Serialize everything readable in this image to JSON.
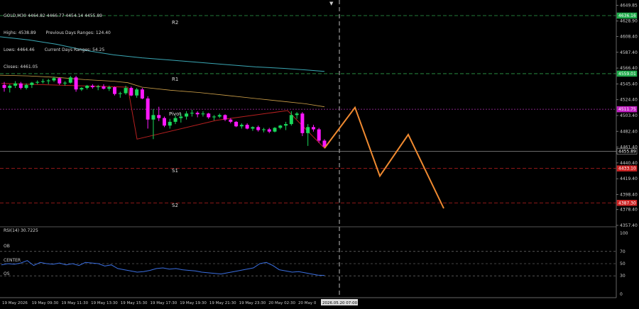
{
  "symbol_line": {
    "symbol": "GOLD,M30",
    "ohlc": "4464.82 4466.77 4454.14 4455.89"
  },
  "stats": {
    "highs": "Highs: 4538.89",
    "prev_range": "Previous Days Ranges: 124.40",
    "lows": "Lows: 4464.46",
    "curr_range": "Current Days Ranges: 54.25",
    "closes": "Closes: 4461.05"
  },
  "dropdown_icon": "triangle-down-icon",
  "pivot_labels": {
    "r2": "R2",
    "r1": "R1",
    "pivot": "Pivot",
    "s1": "S1",
    "s2": "S2"
  },
  "price_axis": {
    "ticks": [
      "4649.85",
      "4628.90",
      "4608.40",
      "4587.40",
      "4566.40",
      "4545.40",
      "4524.40",
      "4503.40",
      "4482.40",
      "4461.40",
      "4440.40",
      "4419.40",
      "4398.40",
      "4378.40",
      "4357.40"
    ],
    "tags": [
      {
        "label": "4636.16",
        "color": "#1faa4a"
      },
      {
        "label": "4559.01",
        "color": "#1faa4a"
      },
      {
        "label": "4511.75",
        "color": "#c020c0"
      },
      {
        "label": "4455.89",
        "color": "#000000"
      },
      {
        "label": "4433.10",
        "color": "#cc2222"
      },
      {
        "label": "4387.30",
        "color": "#cc2222"
      }
    ]
  },
  "rsi": {
    "label": "RSI(14) 30.7225",
    "levels_text": {
      "ob": "OB",
      "center": "CENTER",
      "os": "OS"
    },
    "ticks": [
      "100",
      "70",
      "50",
      "30",
      "0"
    ]
  },
  "time_axis": {
    "labels": [
      "19 May 2026",
      "19 May 09:30",
      "19 May 11:30",
      "19 May 13:30",
      "19 May 15:30",
      "19 May 17:30",
      "19 May 19:30",
      "19 May 21:30",
      "19 May 23:30",
      "20 May 02:30",
      "20 May 0"
    ],
    "crosshair_label": "2026.05.20 07:00"
  },
  "colors": {
    "bull": "#19d85a",
    "bear": "#ff18ff",
    "ma_slow": "#3aa7b4",
    "ma_fast": "#d0a24a",
    "zigzag": "#b82020",
    "forecast": "#f08a30",
    "rsi_line": "#3a6ee0"
  },
  "chart_data": {
    "type": "candlestick",
    "price_range": [
      4357.4,
      4655
    ],
    "candles": [
      [
        4544,
        4548,
        4535,
        4540
      ],
      [
        4540,
        4545,
        4534,
        4543
      ],
      [
        4543,
        4549,
        4540,
        4546
      ],
      [
        4546,
        4548,
        4538,
        4540
      ],
      [
        4540,
        4546,
        4538,
        4544
      ],
      [
        4544,
        4548,
        4540,
        4547
      ],
      [
        4547,
        4550,
        4545,
        4548
      ],
      [
        4548,
        4552,
        4546,
        4549
      ],
      [
        4549,
        4552,
        4545,
        4550
      ],
      [
        4550,
        4555,
        4548,
        4553
      ],
      [
        4553,
        4554,
        4544,
        4546
      ],
      [
        4546,
        4549,
        4543,
        4547
      ],
      [
        4547,
        4556,
        4546,
        4554
      ],
      [
        4554,
        4556,
        4535,
        4538
      ],
      [
        4538,
        4541,
        4536,
        4540
      ],
      [
        4540,
        4544,
        4538,
        4543
      ],
      [
        4543,
        4545,
        4539,
        4541
      ],
      [
        4541,
        4544,
        4537,
        4542
      ],
      [
        4542,
        4545,
        4538,
        4539
      ],
      [
        4539,
        4543,
        4536,
        4541
      ],
      [
        4541,
        4542,
        4530,
        4532
      ],
      [
        4532,
        4535,
        4527,
        4533
      ],
      [
        4533,
        4543,
        4531,
        4540
      ],
      [
        4540,
        4542,
        4529,
        4530
      ],
      [
        4530,
        4540,
        4527,
        4538
      ],
      [
        4538,
        4540,
        4525,
        4526
      ],
      [
        4526,
        4529,
        4486,
        4498
      ],
      [
        4498,
        4512,
        4472,
        4504
      ],
      [
        4504,
        4515,
        4496,
        4500
      ],
      [
        4500,
        4502,
        4488,
        4490
      ],
      [
        4490,
        4499,
        4486,
        4495
      ],
      [
        4495,
        4503,
        4492,
        4500
      ],
      [
        4500,
        4506,
        4494,
        4502
      ],
      [
        4502,
        4509,
        4498,
        4506
      ],
      [
        4506,
        4511,
        4502,
        4507
      ],
      [
        4507,
        4509,
        4501,
        4505
      ],
      [
        4505,
        4509,
        4502,
        4506
      ],
      [
        4506,
        4507,
        4499,
        4501
      ],
      [
        4501,
        4504,
        4497,
        4502
      ],
      [
        4502,
        4506,
        4500,
        4504
      ],
      [
        4504,
        4505,
        4496,
        4498
      ],
      [
        4498,
        4500,
        4493,
        4495
      ],
      [
        4495,
        4496,
        4488,
        4489
      ],
      [
        4489,
        4493,
        4486,
        4491
      ],
      [
        4491,
        4493,
        4485,
        4486
      ],
      [
        4486,
        4489,
        4483,
        4488
      ],
      [
        4488,
        4490,
        4482,
        4484
      ],
      [
        4484,
        4487,
        4481,
        4485
      ],
      [
        4485,
        4487,
        4480,
        4482
      ],
      [
        4482,
        4488,
        4481,
        4487
      ],
      [
        4487,
        4491,
        4485,
        4490
      ],
      [
        4490,
        4495,
        4484,
        4492
      ],
      [
        4492,
        4509,
        4490,
        4504
      ],
      [
        4504,
        4508,
        4499,
        4506
      ],
      [
        4506,
        4508,
        4476,
        4480
      ],
      [
        4480,
        4492,
        4463,
        4488
      ],
      [
        4488,
        4491,
        4482,
        4485
      ],
      [
        4485,
        4487,
        4467,
        4470
      ],
      [
        4470,
        4472,
        4460,
        4462
      ]
    ],
    "ma_slow": [
      [
        0,
        4608
      ],
      [
        40,
        4604
      ],
      [
        80,
        4598
      ],
      [
        120,
        4590
      ],
      [
        160,
        4584
      ],
      [
        200,
        4580
      ],
      [
        240,
        4577
      ],
      [
        280,
        4574
      ],
      [
        320,
        4571
      ],
      [
        360,
        4568
      ],
      [
        400,
        4566
      ],
      [
        430,
        4564
      ],
      [
        457,
        4562
      ]
    ],
    "ma_fast": [
      [
        0,
        4557
      ],
      [
        40,
        4556
      ],
      [
        80,
        4554
      ],
      [
        120,
        4551
      ],
      [
        160,
        4549
      ],
      [
        180,
        4547
      ],
      [
        200,
        4541
      ],
      [
        240,
        4537
      ],
      [
        280,
        4534
      ],
      [
        320,
        4530
      ],
      [
        360,
        4526
      ],
      [
        400,
        4522
      ],
      [
        430,
        4519
      ],
      [
        457,
        4515
      ]
    ],
    "zigzag": [
      [
        2,
        4546
      ],
      [
        180,
        4541
      ],
      [
        193,
        4472
      ],
      [
        305,
        4497
      ],
      [
        405,
        4510
      ],
      [
        457,
        4460
      ]
    ],
    "forecast": [
      [
        457,
        4460
      ],
      [
        500,
        4514
      ],
      [
        535,
        4423
      ],
      [
        575,
        4478
      ],
      [
        625,
        4380
      ]
    ],
    "pivot_levels": {
      "r2": 4636.16,
      "r1": 4559.01,
      "pivot": 4511.75,
      "s1": 4433.1,
      "s2": 4387.3
    },
    "current_price": 4455.89,
    "rsi_values": [
      48,
      50,
      49,
      51,
      55,
      47,
      52,
      50,
      49,
      51,
      48,
      50,
      47,
      52,
      51,
      50,
      46,
      48,
      42,
      40,
      38,
      36,
      37,
      39,
      42,
      43,
      41,
      42,
      40,
      39,
      38,
      36,
      35,
      34,
      33,
      35,
      37,
      39,
      41,
      43,
      50,
      52,
      47,
      40,
      38,
      36,
      37,
      35,
      33,
      31,
      30.7
    ],
    "rsi_levels": {
      "ob": 70,
      "center": 50,
      "os": 30
    }
  }
}
